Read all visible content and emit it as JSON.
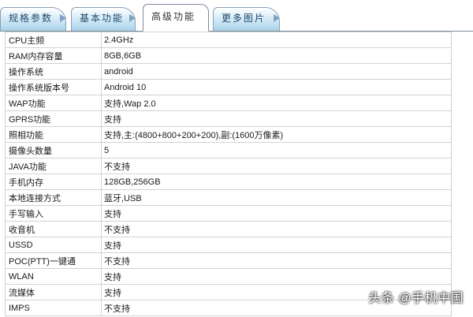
{
  "tabs": [
    {
      "label": "规格参数",
      "active": false
    },
    {
      "label": "基本功能",
      "active": false
    },
    {
      "label": "高级功能",
      "active": true
    },
    {
      "label": "更多图片",
      "active": false
    }
  ],
  "specs": [
    {
      "key": "CPU主频",
      "value": "2.4GHz"
    },
    {
      "key": "RAM内存容量",
      "value": "8GB,6GB"
    },
    {
      "key": "操作系统",
      "value": "android"
    },
    {
      "key": "操作系统版本号",
      "value": "Android 10"
    },
    {
      "key": "WAP功能",
      "value": "支持,Wap 2.0"
    },
    {
      "key": "GPRS功能",
      "value": "支持"
    },
    {
      "key": "照相功能",
      "value": "支持,主:(4800+800+200+200),副:(1600万像素)"
    },
    {
      "key": "摄像头数量",
      "value": "5"
    },
    {
      "key": "JAVA功能",
      "value": "不支持"
    },
    {
      "key": "手机内存",
      "value": "128GB,256GB"
    },
    {
      "key": "本地连接方式",
      "value": "蓝牙,USB"
    },
    {
      "key": "手写输入",
      "value": "支持"
    },
    {
      "key": "收音机",
      "value": "不支持"
    },
    {
      "key": "USSD",
      "value": "支持"
    },
    {
      "key": "POC(PTT)一键通",
      "value": "不支持"
    },
    {
      "key": "WLAN",
      "value": "支持"
    },
    {
      "key": "流媒体",
      "value": "支持"
    },
    {
      "key": "IMPS",
      "value": "不支持"
    }
  ],
  "watermark": "头条 @手机中国"
}
